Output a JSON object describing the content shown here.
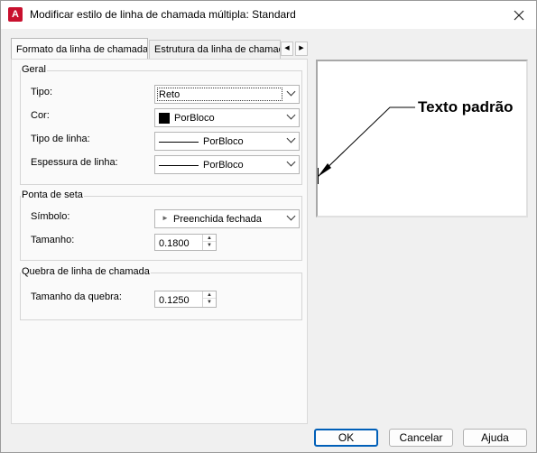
{
  "window": {
    "title": "Modificar estilo de linha de chamada múltipla: Standard",
    "app_icon_letter": "A"
  },
  "tabs": [
    {
      "label": "Formato da linha de chamada",
      "active": true
    },
    {
      "label": "Estrutura da linha de chamada",
      "active": false
    }
  ],
  "groups": {
    "geral": {
      "title": "Geral",
      "fields": [
        {
          "label": "Tipo:",
          "value": "Reto"
        },
        {
          "label": "Cor:",
          "value": "PorBloco",
          "swatch_color": "#000000"
        },
        {
          "label": "Tipo de linha:",
          "value": "PorBloco"
        },
        {
          "label": "Espessura de linha:",
          "value": "PorBloco"
        }
      ]
    },
    "ponta": {
      "title": "Ponta de seta",
      "simbolo_label": "Símbolo:",
      "simbolo_value": "Preenchida fechada",
      "tamanho_label": "Tamanho:",
      "tamanho_value": "0.1800"
    },
    "quebra": {
      "title": "Quebra de linha de chamada",
      "tamanho_label": "Tamanho da quebra:",
      "tamanho_value": "0.1250"
    }
  },
  "preview": {
    "text": "Texto padrão"
  },
  "buttons": {
    "ok": "OK",
    "cancel": "Cancelar",
    "help": "Ajuda"
  },
  "colors": {
    "accent": "#005fb8",
    "app_icon": "#c8102e"
  }
}
